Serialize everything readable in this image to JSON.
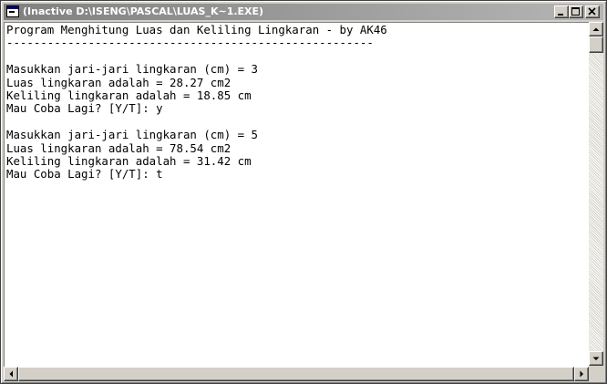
{
  "window": {
    "title": "(Inactive D:\\ISENG\\PASCAL\\LUAS_K~1.EXE)",
    "icon": "console-icon",
    "controls": [
      "minimize-icon",
      "maximize-icon",
      "close-icon"
    ]
  },
  "console": {
    "lines": [
      "Program Menghitung Luas dan Keliling Lingkaran - by AK46",
      "------------------------------------------------------",
      "",
      "Masukkan jari-jari lingkaran (cm) = 3",
      "Luas lingkaran adalah = 28.27 cm2",
      "Keliling lingkaran adalah = 18.85 cm",
      "Mau Coba Lagi? [Y/T]: y",
      "",
      "Masukkan jari-jari lingkaran (cm) = 5",
      "Luas lingkaran adalah = 78.54 cm2",
      "Keliling lingkaran adalah = 31.42 cm",
      "Mau Coba Lagi? [Y/T]: t"
    ]
  },
  "colors": {
    "inactive_title_start": "#808080",
    "inactive_title_end": "#b5b5b5",
    "console_background": "#ffffff",
    "console_text": "#000000"
  }
}
